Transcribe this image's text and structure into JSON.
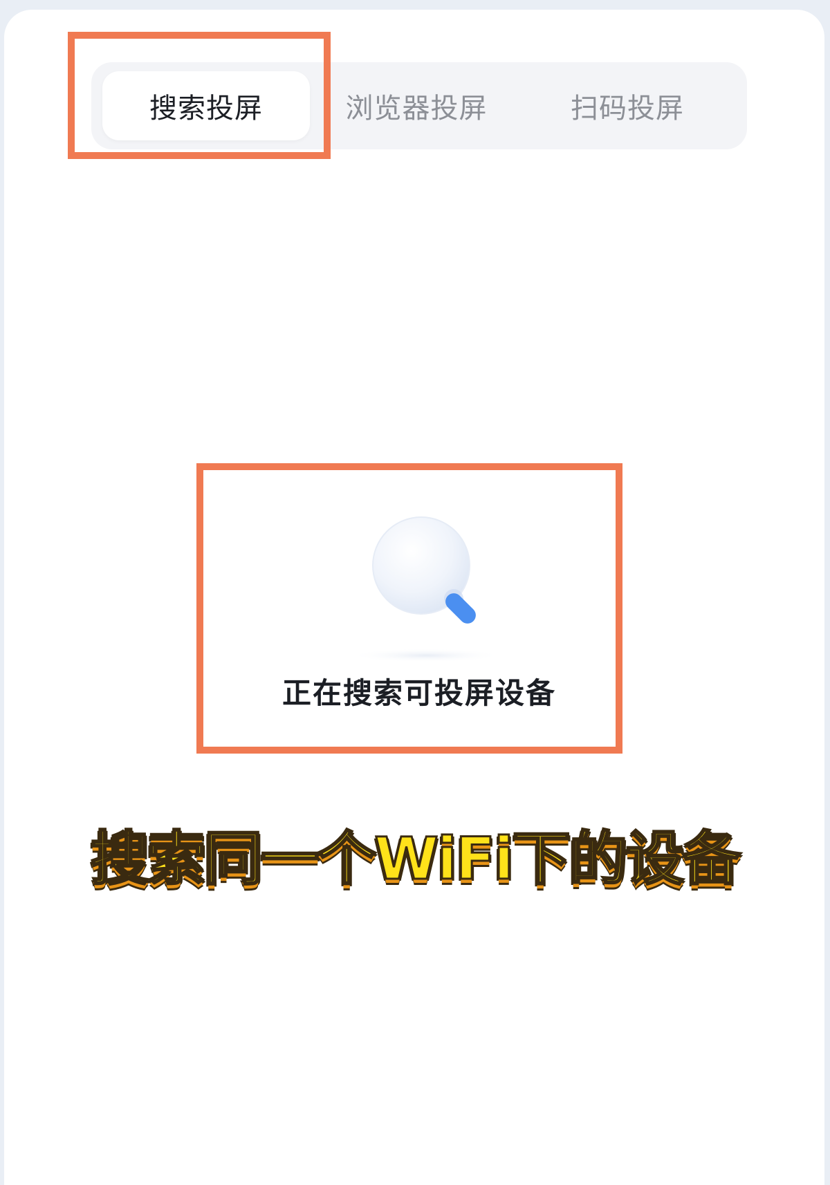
{
  "tabs": [
    {
      "label": "搜索投屏",
      "active": true
    },
    {
      "label": "浏览器投屏",
      "active": false
    },
    {
      "label": "扫码投屏",
      "active": false
    }
  ],
  "search_status": {
    "icon": "magnifier-icon",
    "text": "正在搜索可投屏设备"
  },
  "caption": {
    "text": "搜索同一个WiFi下的设备"
  },
  "colors": {
    "highlight": "#f07a52",
    "caption_fill": "#ffe21a",
    "magnifier_handle": "#4b8ff0"
  }
}
